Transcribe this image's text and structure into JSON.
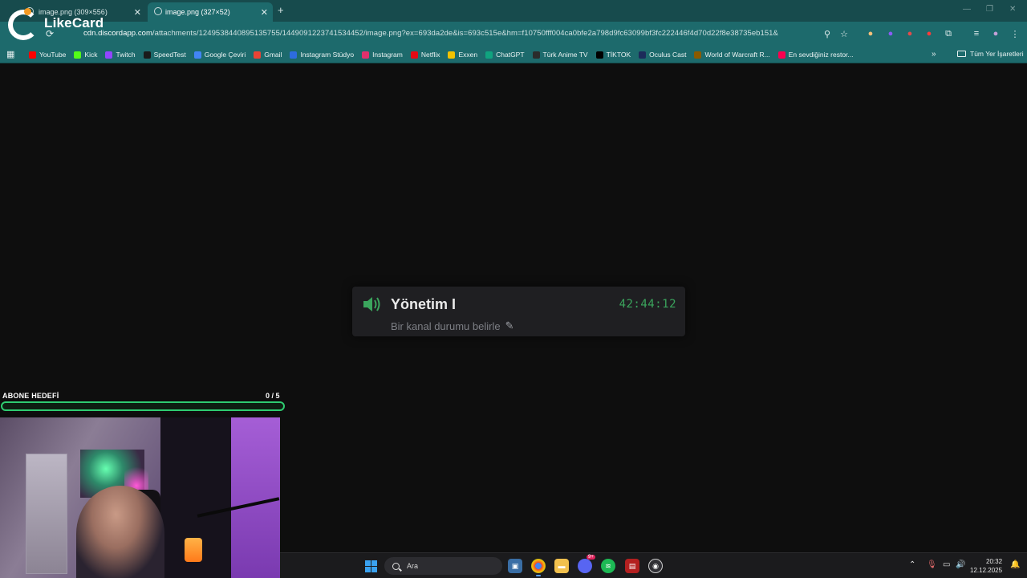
{
  "browser": {
    "tabs": [
      {
        "title": "image.png (309×556)",
        "active": false
      },
      {
        "title": "image.png (327×52)",
        "active": true
      }
    ],
    "new_tab_label": "+",
    "url_host": "cdn.discordapp.com",
    "url_path": "/attachments/1249538440895135755/1449091223741534452/image.png?ex=693da2de&is=693c515e&hm=f10750fff004ca0bfe2a798d9fc63099bf3fc222446f4d70d22f8e38735eb151&"
  },
  "bookmarks": [
    {
      "label": "YouTube",
      "color": "#ff0000"
    },
    {
      "label": "Kick",
      "color": "#53fc18"
    },
    {
      "label": "Twitch",
      "color": "#9146ff"
    },
    {
      "label": "SpeedTest",
      "color": "#1a1a1a"
    },
    {
      "label": "Google Çeviri",
      "color": "#4285f4"
    },
    {
      "label": "Gmail",
      "color": "#ea4335"
    },
    {
      "label": "Instagram Stüdyo",
      "color": "#2d6cdf"
    },
    {
      "label": "Instagram",
      "color": "#e1306c"
    },
    {
      "label": "Netflix",
      "color": "#e50914"
    },
    {
      "label": "Exxen",
      "color": "#f2c200"
    },
    {
      "label": "ChatGPT",
      "color": "#10a37f"
    },
    {
      "label": "Türk Anime TV",
      "color": "#2b2b2b"
    },
    {
      "label": "TİKTOK",
      "color": "#000000"
    },
    {
      "label": "Oculus Cast",
      "color": "#1c2b5a"
    },
    {
      "label": "World of Warcraft R...",
      "color": "#8a5a00"
    },
    {
      "label": "En sevdiğiniz restor...",
      "color": "#fa0050"
    }
  ],
  "all_bookmarks_label": "Tüm Yer İşaretleri",
  "overlay_logo_text": "LikeCard",
  "discord": {
    "channel_name": "Yönetim I",
    "timer": "42:44:12",
    "status_placeholder": "Bir kanal durumu belirle",
    "accent": "#3ba55d"
  },
  "sub_goal": {
    "label": "ABONE HEDEFİ",
    "count": "0 / 5",
    "progress": 0,
    "color": "#2ecc71"
  },
  "taskbar": {
    "search_placeholder": "Ara",
    "time": "20:32",
    "date": "12.12.2025",
    "discord_badge": "9+"
  }
}
